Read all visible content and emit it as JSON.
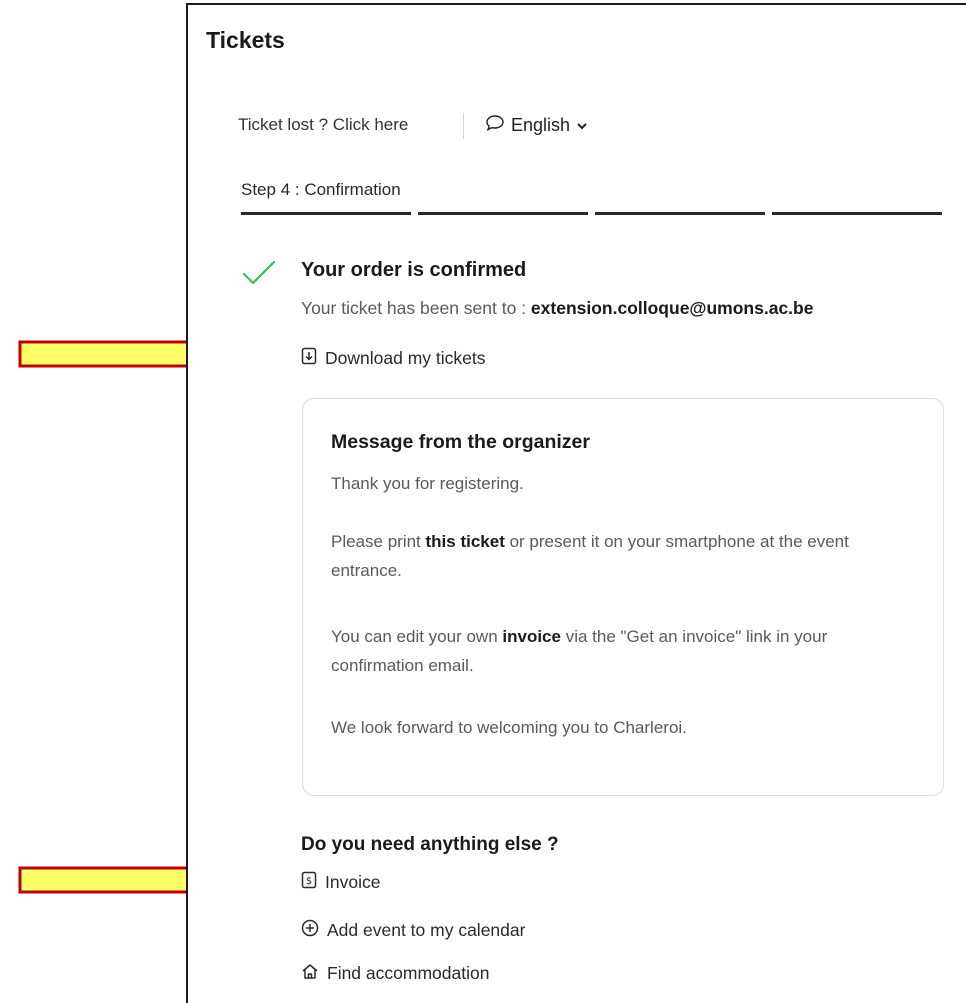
{
  "header": {
    "title": "Tickets"
  },
  "toolbar": {
    "ticket_lost_label": "Ticket lost ? Click here",
    "language_label": "English"
  },
  "stepper": {
    "step_label": "Step 4 : Confirmation",
    "total_steps": 4,
    "completed_steps": 4
  },
  "confirmation": {
    "heading": "Your order is confirmed",
    "sent_prefix": "Your ticket has been sent to : ",
    "email": "extension.colloque@umons.ac.be",
    "download_label": "Download my tickets"
  },
  "organizer_message": {
    "title": "Message from the organizer",
    "line1": "Thank you for registering.",
    "p2_before": "Please print ",
    "p2_bold": "this ticket",
    "p2_after": " or present it on your smartphone at the event entrance.",
    "p3_before": "You can edit your own ",
    "p3_bold": "invoice",
    "p3_after": " via the \"Get an invoice\" link in your confirmation email.",
    "line4": "We look forward to welcoming you to Charleroi."
  },
  "extras": {
    "heading": "Do you need anything else ?",
    "items": [
      {
        "label": "Invoice",
        "icon": "invoice-icon"
      },
      {
        "label": "Add event to my calendar",
        "icon": "plus-circle-icon"
      },
      {
        "label": "Find accommodation",
        "icon": "home-icon"
      }
    ]
  },
  "colors": {
    "check": "#2fbf5b",
    "arrow_fill": "#ffff66",
    "arrow_stroke": "#c00000"
  }
}
